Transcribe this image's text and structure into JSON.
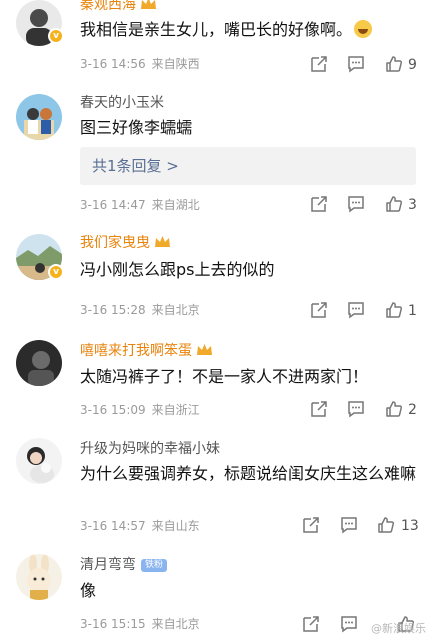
{
  "comments": [
    {
      "name": "秦观西海",
      "text": "我相信是亲生女儿，嘴巴长的好像啊。",
      "date": "3-16 14:56",
      "location": "来自陕西",
      "likes": "9"
    },
    {
      "name": "春天的小玉米",
      "text": "图三好像李蠕蠕",
      "reply_summary": "共1条回复 >",
      "date": "3-16 14:47",
      "location": "来自湖北",
      "likes": "3"
    },
    {
      "name": "我们家曳曳",
      "text": "冯小刚怎么跟ps上去的似的",
      "date": "3-16 15:28",
      "location": "来自北京",
      "likes": "1"
    },
    {
      "name": "嘻嘻来打我啊笨蛋",
      "text": "太随冯裤子了！不是一家人不进两家门！",
      "date": "3-16 15:09",
      "location": "来自浙江",
      "likes": "2"
    },
    {
      "name": "升级为妈咪的幸福小妹",
      "text": "为什么要强调养女，标题说给闺女庆生这么难嘛",
      "date": "3-16 14:57",
      "location": "来自山东",
      "likes": "13"
    },
    {
      "name": "清月弯弯",
      "badge": "铁粉",
      "text": "像",
      "date": "3-16 15:15",
      "location": "来自北京",
      "likes": ""
    }
  ],
  "watermark": "@新浪娱乐",
  "colors": {
    "gold_name": "#e8830c",
    "gray_name": "#555555",
    "meta": "#9a9a9a",
    "reply_link": "#5a6f94"
  },
  "icons": [
    "share-icon",
    "comment-icon",
    "like-icon",
    "verified-badge-icon",
    "crown-icon"
  ]
}
